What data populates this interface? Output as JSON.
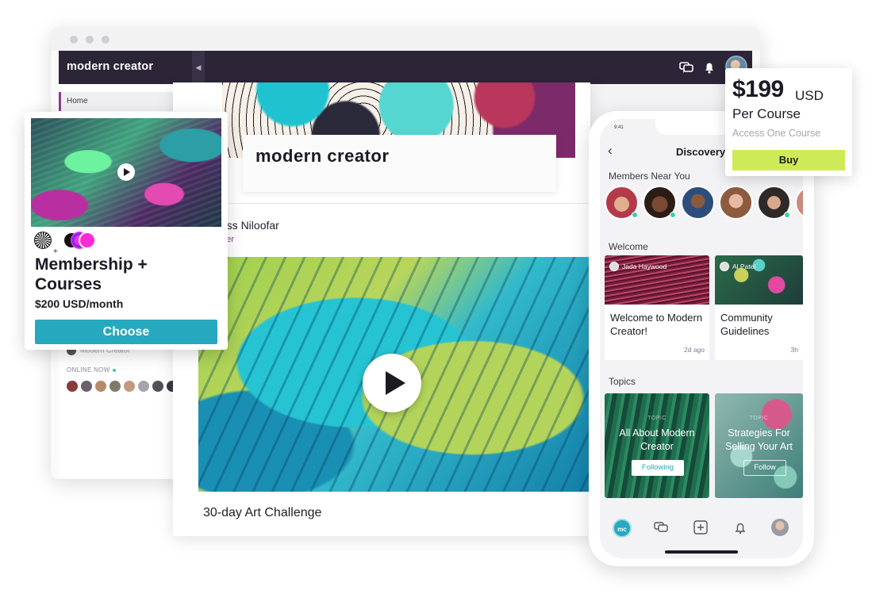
{
  "browser": {
    "brand": "modern creator",
    "sidebar": {
      "home_label": "Home",
      "community_label": "Modern Creator",
      "online_label": "ONLINE NOW"
    }
  },
  "course": {
    "cover_title": "modern creator",
    "author_name": "Chass Niloofar",
    "author_role": "Painter",
    "title": "30-day Art Challenge"
  },
  "membership": {
    "title": "Membership + Courses",
    "price": "$200 USD/month",
    "choose_label": "Choose",
    "plus": "+"
  },
  "phone": {
    "status_time": "9:41",
    "header_title": "Discovery",
    "members_label": "Members Near You",
    "welcome_label": "Welcome",
    "topics_label": "Topics",
    "posts": [
      {
        "author": "Jada Haywood",
        "title": "Welcome to Modern Creator!",
        "time": "2d ago"
      },
      {
        "author": "Al Patel",
        "title": "Community Guidelines",
        "time": "3h"
      }
    ],
    "topics": [
      {
        "kicker": "TOPIC",
        "title": "All About Modern Creator",
        "button": "Following"
      },
      {
        "kicker": "TOPIC",
        "title": "Strategies For Selling Your Art",
        "button": "Follow"
      }
    ],
    "tab_home_badge": "mc"
  },
  "price_card": {
    "amount": "$199",
    "currency": "USD",
    "per": "Per Course",
    "access": "Access One Course",
    "buy_label": "Buy"
  },
  "colors": {
    "header_dark": "#2c2538",
    "accent_teal": "#26a9bf",
    "buy_lime": "#cfea57",
    "role_purple": "#8a3b96",
    "online_green": "#36d1a6"
  }
}
